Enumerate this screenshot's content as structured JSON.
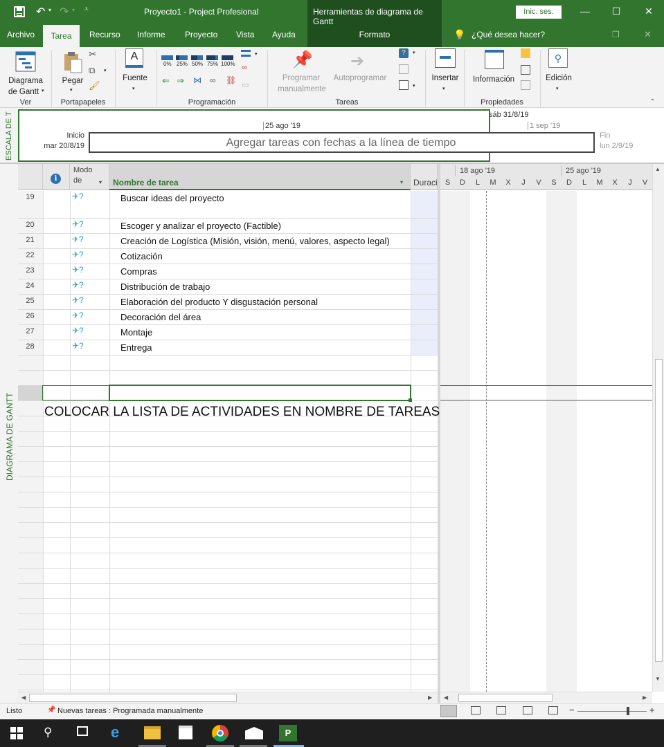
{
  "window": {
    "title": "Proyecto1  -  Project Profesional",
    "context_tools": "Herramientas de diagrama de Gantt",
    "signin": "Inic. ses."
  },
  "tabs": {
    "archivo": "Archivo",
    "tarea": "Tarea",
    "recurso": "Recurso",
    "informe": "Informe",
    "proyecto": "Proyecto",
    "vista": "Vista",
    "ayuda": "Ayuda",
    "formato": "Formato",
    "search": "¿Qué desea hacer?"
  },
  "ribbon": {
    "ver": {
      "btn1": "Diagrama",
      "btn2": "de Gantt",
      "label": "Ver"
    },
    "portapapeles": {
      "pegar": "Pegar",
      "label": "Portapapeles"
    },
    "fuente": {
      "btn": "Fuente"
    },
    "programacion": {
      "label": "Programación",
      "pcts": [
        "0%",
        "25%",
        "50%",
        "75%",
        "100%"
      ]
    },
    "tareas": {
      "manual1": "Programar",
      "manual2": "manualmente",
      "auto": "Autoprogramar",
      "label": "Tareas"
    },
    "insertar": {
      "btn": "Insertar"
    },
    "propiedades": {
      "btn": "Información",
      "label": "Propiedades"
    },
    "edicion": {
      "btn": "Edición"
    }
  },
  "timeline": {
    "side_label": "ESCALA DE T",
    "start_label": "Inicio",
    "start_date": "mar 20/8/19",
    "date_top": "25 ago '19",
    "date_right": "sáb 31/8/19",
    "date_right2": "1 sep '19",
    "placeholder": "Agregar tareas con fechas a la línea de tiempo",
    "end_label": "Fin",
    "end_date": "lun 2/9/19"
  },
  "grid": {
    "col_mode1": "Modo",
    "col_mode2": "de",
    "col_name": "Nombre de tarea",
    "col_dur": "Duraci",
    "side_label": "DIAGRAMA DE GANTT",
    "rows": [
      {
        "id": "19",
        "name": "Buscar ideas del proyecto"
      },
      {
        "id": "20",
        "name": "Escoger y analizar el proyecto (Factible)"
      },
      {
        "id": "21",
        "name": "Creación de Logística (Misión, visión, menú, valores, aspecto legal)"
      },
      {
        "id": "22",
        "name": "Cotización"
      },
      {
        "id": "23",
        "name": "Compras"
      },
      {
        "id": "24",
        "name": "Distribución de trabajo"
      },
      {
        "id": "25",
        "name": "Elaboración del producto Y disgustación personal"
      },
      {
        "id": "26",
        "name": "Decoración del área"
      },
      {
        "id": "27",
        "name": "Montaje"
      },
      {
        "id": "28",
        "name": "Entrega"
      }
    ],
    "overlay_note": "COLOCAR LA LISTA DE ACTIVIDADES EN NOMBRE DE TAREAS"
  },
  "gantt": {
    "week1": "18 ago '19",
    "week2": "25 ago '19",
    "days": [
      "S",
      "D",
      "L",
      "M",
      "X",
      "J",
      "V",
      "S",
      "D",
      "L",
      "M",
      "X",
      "J",
      "V"
    ]
  },
  "status": {
    "ready": "Listo",
    "new_tasks": "Nuevas tareas : Programada manualmente"
  },
  "colors": {
    "brand": "#31752f",
    "dark": "#1f4e1f"
  }
}
